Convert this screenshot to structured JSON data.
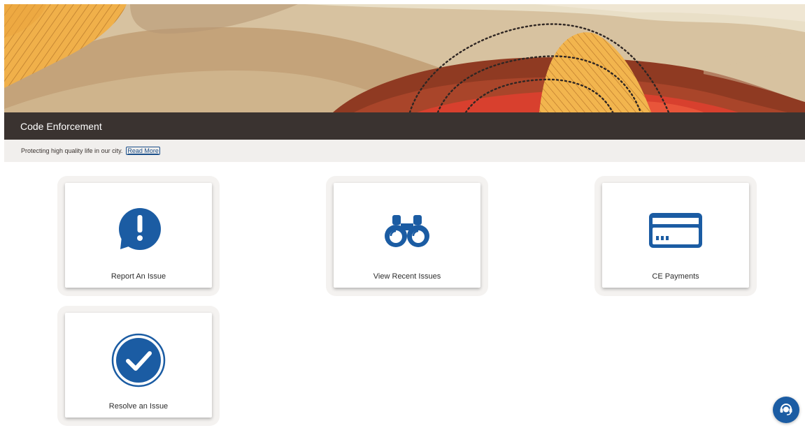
{
  "header": {
    "title": "Code Enforcement",
    "description": "Protecting high quality life in our city.",
    "read_more_label": "Read More"
  },
  "tiles": [
    {
      "label": "Report An Issue",
      "icon": "exclamation-speech-bubble-icon"
    },
    {
      "label": "View Recent Issues",
      "icon": "binoculars-icon"
    },
    {
      "label": "CE Payments",
      "icon": "credit-card-icon"
    },
    {
      "label": "Resolve an Issue",
      "icon": "checkmark-circle-icon"
    }
  ],
  "help_button": {
    "icon": "headset-support-icon"
  },
  "colors": {
    "accent_blue": "#1b5ca3",
    "title_bar": "#3a3330",
    "subtitle_bar": "#f1efed"
  }
}
